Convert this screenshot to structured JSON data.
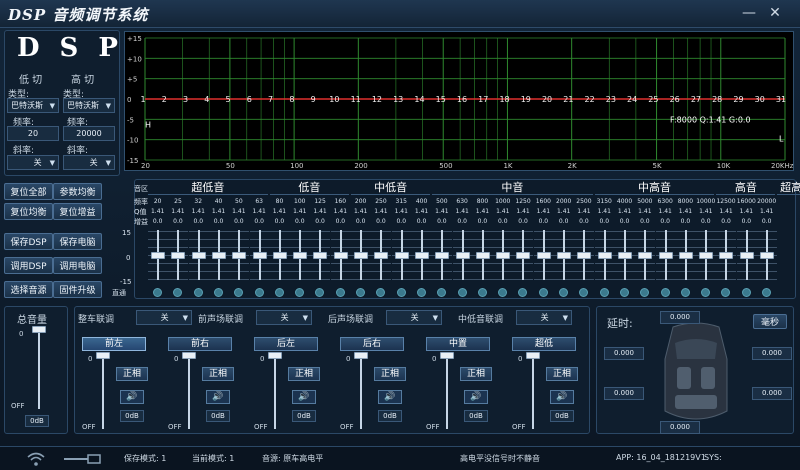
{
  "app": {
    "title": "DSP 音频调节系统",
    "minimize": "—",
    "close": "✕"
  },
  "crossover": {
    "logo": "DSP",
    "low_title": "低 切",
    "high_title": "高 切",
    "type_label": "类型:",
    "freq_label": "频率:",
    "slope_label": "斜率:",
    "low_type": "巴特沃斯",
    "high_type": "巴特沃斯",
    "low_freq": "20",
    "high_freq": "20000",
    "low_slope": "关",
    "high_slope": "关"
  },
  "side_buttons": [
    "复位全部",
    "参数均衡",
    "复位均衡",
    "复位增益",
    "保存DSP",
    "保存电脑",
    "调用DSP",
    "调用电脑",
    "选择音源",
    "固件升级"
  ],
  "graph": {
    "y_ticks": [
      "+15",
      "+10",
      "+5",
      "0",
      "-5",
      "-10",
      "-15"
    ],
    "x_ticks": [
      "20",
      "50",
      "100",
      "200",
      "500",
      "1K",
      "2K",
      "5K",
      "10K",
      "20KHz"
    ],
    "band_markers": [
      "1",
      "2",
      "3",
      "4",
      "5",
      "6",
      "7",
      "8",
      "9",
      "10",
      "11",
      "12",
      "13",
      "14",
      "15",
      "16",
      "17",
      "18",
      "19",
      "20",
      "21",
      "22",
      "23",
      "24",
      "25",
      "26",
      "27",
      "28",
      "29",
      "30",
      "31"
    ],
    "readout": "F:8000 Q:1.41 G:0.0",
    "h_marker": "H",
    "l_marker": "L",
    "curve_color": "#e0312e",
    "grid_color": "#2f8a2f"
  },
  "eq": {
    "row_labels": {
      "band": "音区",
      "freq": "频率",
      "q": "Q值",
      "gain": "增益"
    },
    "bands": [
      {
        "name": "超低音",
        "span": 6
      },
      {
        "name": "低音",
        "span": 4
      },
      {
        "name": "中低音",
        "span": 4
      },
      {
        "name": "中音",
        "span": 8
      },
      {
        "name": "中高音",
        "span": 6
      },
      {
        "name": "高音",
        "span": 3
      },
      {
        "name": "超高音",
        "span": 2
      }
    ],
    "freqs": [
      "20",
      "25",
      "32",
      "40",
      "50",
      "63",
      "80",
      "100",
      "125",
      "160",
      "200",
      "250",
      "315",
      "400",
      "500",
      "630",
      "800",
      "1000",
      "1250",
      "1600",
      "2000",
      "2500",
      "3150",
      "4000",
      "5000",
      "6300",
      "8000",
      "10000",
      "12500",
      "16000",
      "20000"
    ],
    "q": [
      "1.41",
      "1.41",
      "1.41",
      "1.41",
      "1.41",
      "1.41",
      "1.41",
      "1.41",
      "1.41",
      "1.41",
      "1.41",
      "1.41",
      "1.41",
      "1.41",
      "1.41",
      "1.41",
      "1.41",
      "1.41",
      "1.41",
      "1.41",
      "1.41",
      "1.41",
      "1.41",
      "1.41",
      "1.41",
      "1.41",
      "1.41",
      "1.41",
      "1.41",
      "1.41",
      "1.41"
    ],
    "gain": [
      "0.0",
      "0.0",
      "0.0",
      "0.0",
      "0.0",
      "0.0",
      "0.0",
      "0.0",
      "0.0",
      "0.0",
      "0.0",
      "0.0",
      "0.0",
      "0.0",
      "0.0",
      "0.0",
      "0.0",
      "0.0",
      "0.0",
      "0.0",
      "0.0",
      "0.0",
      "0.0",
      "0.0",
      "0.0",
      "0.0",
      "0.0",
      "0.0",
      "0.0",
      "0.0",
      "0.0"
    ],
    "scale": {
      "top": "15",
      "mid": "0",
      "bot": "-15"
    },
    "bypass_label": "直通"
  },
  "master": {
    "title": "总音量",
    "top": "0",
    "bottom": "OFF",
    "value": "0dB",
    "level": 1.0
  },
  "links": [
    {
      "label": "整车联调",
      "value": "关"
    },
    {
      "label": "前声场联调",
      "value": "关"
    },
    {
      "label": "后声场联调",
      "value": "关"
    },
    {
      "label": "中低音联调",
      "value": "关"
    }
  ],
  "channels": [
    {
      "name": "前左",
      "phase": "正相",
      "db": "0dB",
      "level": 1.0,
      "active": true
    },
    {
      "name": "前右",
      "phase": "正相",
      "db": "0dB",
      "level": 1.0,
      "active": false
    },
    {
      "name": "后左",
      "phase": "正相",
      "db": "0dB",
      "level": 1.0,
      "active": false
    },
    {
      "name": "后右",
      "phase": "正相",
      "db": "0dB",
      "level": 1.0,
      "active": false
    },
    {
      "name": "中置",
      "phase": "正相",
      "db": "0dB",
      "level": 1.0,
      "active": false
    },
    {
      "name": "超低",
      "phase": "正相",
      "db": "0dB",
      "level": 1.0,
      "active": false
    }
  ],
  "channel_scale": {
    "top": "0",
    "bottom": "OFF"
  },
  "speaker_glyph": "🔊",
  "delay": {
    "title": "延时:",
    "unit_btn": "毫秒",
    "values": [
      "0.000",
      "0.000",
      "0.000",
      "0.000",
      "0.000",
      "0.000"
    ]
  },
  "status": {
    "save_mode": "保存模式: 1",
    "current_mode": "当前模式: 1",
    "source": "音源: 原车高电平",
    "signal": "高电平没信号时不静音",
    "app": "APP: 16_04_181219V1",
    "sys": "SYS:"
  }
}
